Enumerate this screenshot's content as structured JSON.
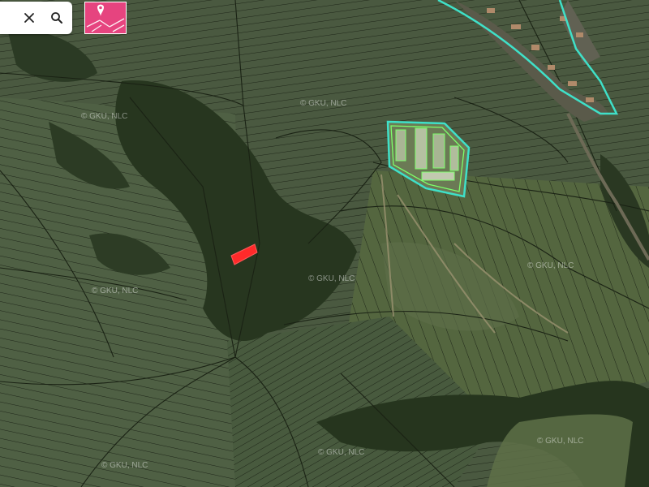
{
  "search": {
    "clear_icon": "close-icon",
    "search_icon": "search-icon"
  },
  "layer_button": {
    "icon": "map-pin-icon",
    "color": "#e6447f"
  },
  "map": {
    "watermark": "© GKU, NLC",
    "highlight_color": "#ff2a2a",
    "outline_color": "#3fe0c8",
    "building_outline_color": "#7dff6a"
  }
}
